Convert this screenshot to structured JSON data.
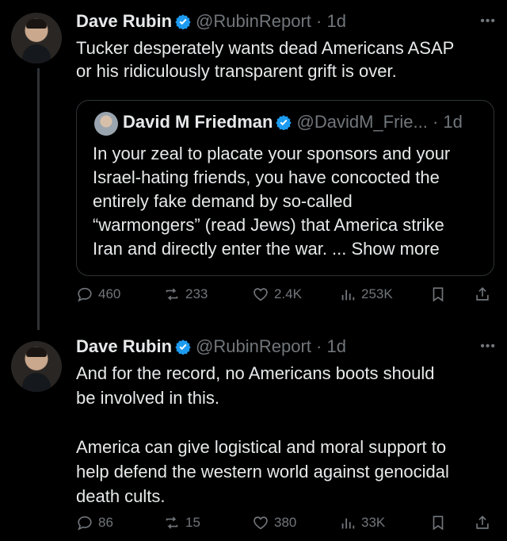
{
  "tweets": [
    {
      "name": "Dave Rubin",
      "handle": "@RubinReport",
      "time": "· 1d",
      "text": "Tucker desperately wants dead Americans ASAP\nor his ridiculously transparent grift is over.",
      "quote": {
        "name": "David M Friedman",
        "handle": "@DavidM_Frie...",
        "time": "· 1d",
        "text": "In your zeal to placate your sponsors and your\nIsrael-hating friends, you have concocted the\nentirely fake demand by so-called\n“warmongers” (read Jews) that America strike\nIran and directly enter the war. ... Show more"
      },
      "replies": "460",
      "reposts": "233",
      "likes": "2.4K",
      "views": "253K"
    },
    {
      "name": "Dave Rubin",
      "handle": "@RubinReport",
      "time": "· 1d",
      "text": "And for the record, no Americans boots should\nbe involved in this.\n\nAmerica can give logistical and moral support to\nhelp defend the western world against genocidal\ndeath cults.",
      "replies": "86",
      "reposts": "15",
      "likes": "380",
      "views": "33K"
    }
  ],
  "colors": {
    "verified": "#1d9bf0",
    "muted": "#71767b",
    "text": "#e7e9ea",
    "background": "#000000"
  }
}
